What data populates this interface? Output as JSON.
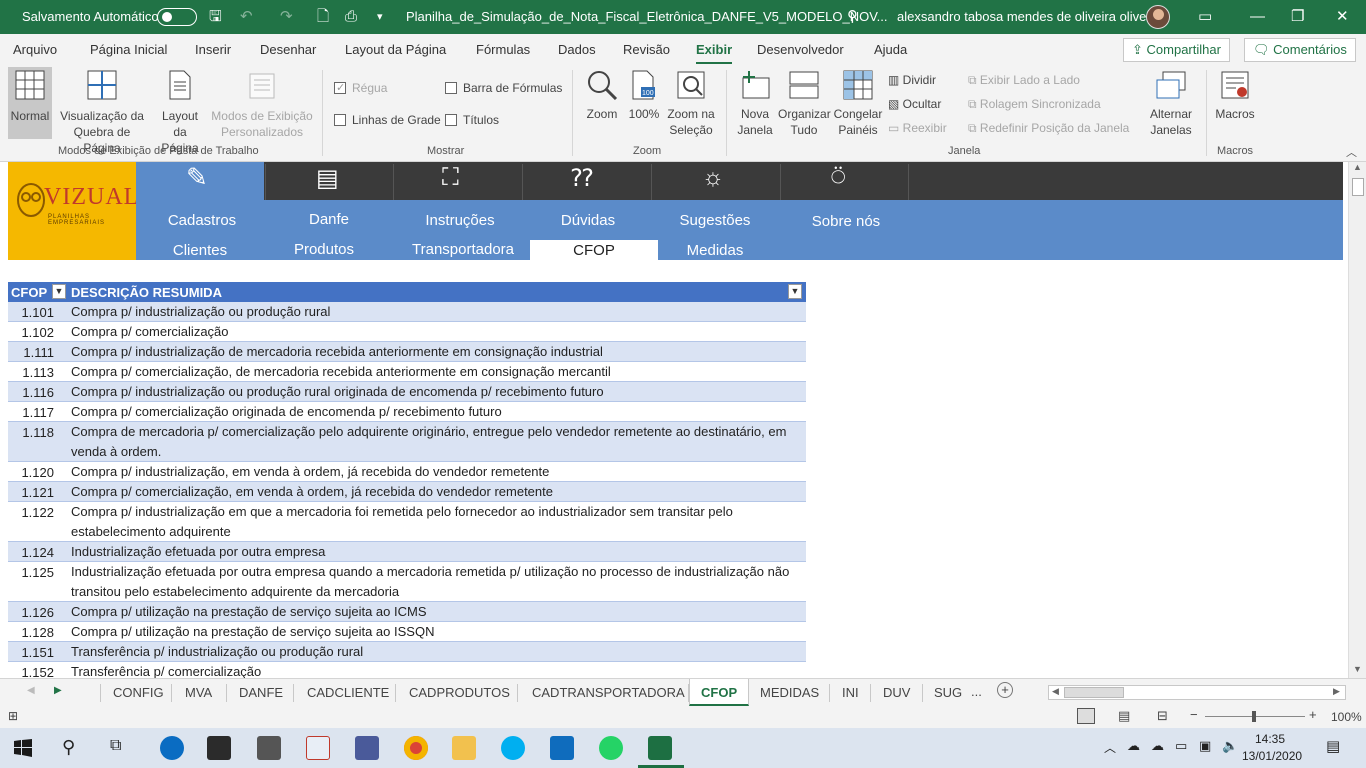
{
  "titlebar": {
    "autosave_label": "Salvamento Automático",
    "filename": "Planilha_de_Simulação_de_Nota_Fiscal_Eletrônica_DANFE_V5_MODELO_NOV...",
    "user": "alexsandro tabosa mendes de oliveira oliveira"
  },
  "menu": {
    "tabs": [
      "Arquivo",
      "Página Inicial",
      "Inserir",
      "Desenhar",
      "Layout da Página",
      "Fórmulas",
      "Dados",
      "Revisão",
      "Exibir",
      "Desenvolvedor",
      "Ajuda"
    ],
    "active": "Exibir",
    "share": "Compartilhar",
    "comments": "Comentários"
  },
  "ribbon": {
    "normal": "Normal",
    "page_break_1": "Visualização da",
    "page_break_2": "Quebra de Página",
    "page_layout_1": "Layout",
    "page_layout_2": "da Página",
    "custom_views_1": "Modos de Exibição",
    "custom_views_2": "Personalizados",
    "group_views": "Modos de Exibição de Pasta de Trabalho",
    "ruler": "Régua",
    "gridlines": "Linhas de Grade",
    "formula_bar": "Barra de Fórmulas",
    "headings": "Títulos",
    "group_show": "Mostrar",
    "zoom": "Zoom",
    "zoom100": "100%",
    "zoom_sel_1": "Zoom na",
    "zoom_sel_2": "Seleção",
    "group_zoom": "Zoom",
    "new_window_1": "Nova",
    "new_window_2": "Janela",
    "arrange_1": "Organizar",
    "arrange_2": "Tudo",
    "freeze_1": "Congelar",
    "freeze_2": "Painéis",
    "split": "Dividir",
    "hide": "Ocultar",
    "unhide": "Reexibir",
    "side_by_side": "Exibir Lado a Lado",
    "sync_scroll": "Rolagem Sincronizada",
    "reset_pos": "Redefinir Posição da Janela",
    "switch_1": "Alternar",
    "switch_2": "Janelas",
    "group_window": "Janela",
    "macros": "Macros",
    "group_macros": "Macros"
  },
  "nav": {
    "logo_text": "VIZUAL",
    "logo_sub": "PLANILHAS EMPRESARIAIS",
    "main": [
      "Cadastros",
      "Danfe",
      "Instruções",
      "Dúvidas",
      "Sugestões",
      "Sobre nós"
    ],
    "sub": [
      "Clientes",
      "Produtos",
      "Transportadora",
      "CFOP",
      "Medidas"
    ],
    "active_sub": "CFOP"
  },
  "table": {
    "headers": [
      "CFOP",
      "DESCRIÇÃO RESUMIDA"
    ],
    "rows": [
      {
        "code": "1.101",
        "desc": "Compra p/ industrialização ou produção rural"
      },
      {
        "code": "1.102",
        "desc": "Compra p/ comercialização"
      },
      {
        "code": "1.111",
        "desc": "Compra p/ industrialização de mercadoria recebida anteriormente em consignação industrial"
      },
      {
        "code": "1.113",
        "desc": "Compra p/ comercialização, de mercadoria recebida anteriormente em consignação mercantil"
      },
      {
        "code": "1.116",
        "desc": "Compra p/ industrialização ou produção rural originada de encomenda p/ recebimento futuro"
      },
      {
        "code": "1.117",
        "desc": "Compra p/ comercialização originada de encomenda p/ recebimento futuro"
      },
      {
        "code": "1.118",
        "desc": "Compra de mercadoria p/ comercialização pelo adquirente originário, entregue pelo vendedor remetente ao destinatário, em venda à ordem."
      },
      {
        "code": "1.120",
        "desc": "Compra p/ industrialização, em venda à ordem, já recebida do vendedor remetente"
      },
      {
        "code": "1.121",
        "desc": "Compra p/ comercialização, em venda à ordem, já recebida do vendedor remetente"
      },
      {
        "code": "1.122",
        "desc": "Compra p/ industrialização em que a mercadoria foi remetida pelo fornecedor ao industrializador sem transitar pelo estabelecimento adquirente"
      },
      {
        "code": "1.124",
        "desc": "Industrialização efetuada por outra empresa"
      },
      {
        "code": "1.125",
        "desc": "Industrialização efetuada por outra empresa quando a mercadoria remetida p/ utilização no processo de industrialização não transitou pelo estabelecimento adquirente da mercadoria"
      },
      {
        "code": "1.126",
        "desc": "Compra p/ utilização na prestação de serviço sujeita ao ICMS"
      },
      {
        "code": "1.128",
        "desc": "Compra p/ utilização na prestação de serviço sujeita ao ISSQN"
      },
      {
        "code": "1.151",
        "desc": "Transferência p/ industrialização ou produção rural"
      },
      {
        "code": "1.152",
        "desc": "Transferência p/ comercialização"
      }
    ]
  },
  "sheet_tabs": {
    "tabs": [
      "CONFIG",
      "MVA",
      "DANFE",
      "CADCLIENTE",
      "CADPRODUTOS",
      "CADTRANSPORTADORA",
      "CFOP",
      "MEDIDAS",
      "INI",
      "DUV",
      "SUG"
    ],
    "active": "CFOP",
    "more": "..."
  },
  "statusbar": {
    "zoom": "100%"
  },
  "taskbar": {
    "time": "14:35",
    "date": "13/01/2020"
  },
  "colors": {
    "excel_green": "#217346",
    "table_header": "#4472c4",
    "nav_blue": "#5b8bc9",
    "logo_yellow": "#f5b800"
  }
}
